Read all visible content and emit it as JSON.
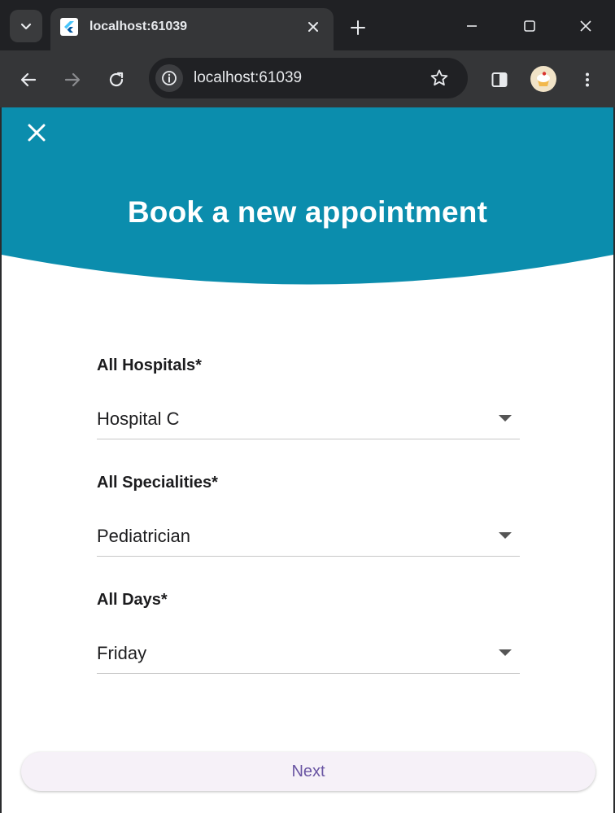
{
  "browser": {
    "tab_title": "localhost:61039",
    "url": "localhost:61039"
  },
  "page": {
    "title": "Book a new appointment",
    "fields": [
      {
        "label": "All Hospitals*",
        "value": "Hospital C"
      },
      {
        "label": "All Specialities*",
        "value": "Pediatrician"
      },
      {
        "label": "All Days*",
        "value": "Friday"
      }
    ],
    "next_label": "Next"
  },
  "colors": {
    "header": "#0b8dad",
    "button_text": "#6a55a3",
    "button_bg": "#f6f1f8"
  }
}
